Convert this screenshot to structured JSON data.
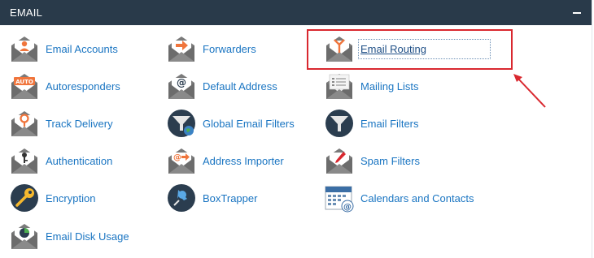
{
  "panel": {
    "title": "EMAIL",
    "collapse_icon": "minus-icon"
  },
  "items": {
    "email_accounts": {
      "label": "Email Accounts",
      "icon": "envelope-person-icon"
    },
    "forwarders": {
      "label": "Forwarders",
      "icon": "envelope-arrow-icon"
    },
    "email_routing": {
      "label": "Email Routing",
      "icon": "envelope-routing-icon"
    },
    "autoresponders": {
      "label": "Autoresponders",
      "icon": "envelope-auto-icon"
    },
    "default_address": {
      "label": "Default Address",
      "icon": "envelope-at-icon"
    },
    "mailing_lists": {
      "label": "Mailing Lists",
      "icon": "envelope-list-icon"
    },
    "track_delivery": {
      "label": "Track Delivery",
      "icon": "envelope-pin-icon"
    },
    "global_email_filters": {
      "label": "Global Email Filters",
      "icon": "funnel-globe-icon"
    },
    "email_filters": {
      "label": "Email Filters",
      "icon": "funnel-icon"
    },
    "authentication": {
      "label": "Authentication",
      "icon": "envelope-key-icon"
    },
    "address_importer": {
      "label": "Address Importer",
      "icon": "envelope-import-icon"
    },
    "spam_filters": {
      "label": "Spam Filters",
      "icon": "envelope-pen-icon"
    },
    "encryption": {
      "label": "Encryption",
      "icon": "key-circle-icon"
    },
    "boxtrapper": {
      "label": "BoxTrapper",
      "icon": "pushpin-circle-icon"
    },
    "calendars_contacts": {
      "label": "Calendars and Contacts",
      "icon": "calendar-at-icon"
    },
    "email_disk_usage": {
      "label": "Email Disk Usage",
      "icon": "envelope-pie-icon"
    }
  },
  "colors": {
    "header_bg": "#293a4a",
    "link": "#1a75c2",
    "highlight": "#d9282f",
    "icon_gray": "#6c6c6c",
    "icon_orange": "#f0753c"
  }
}
